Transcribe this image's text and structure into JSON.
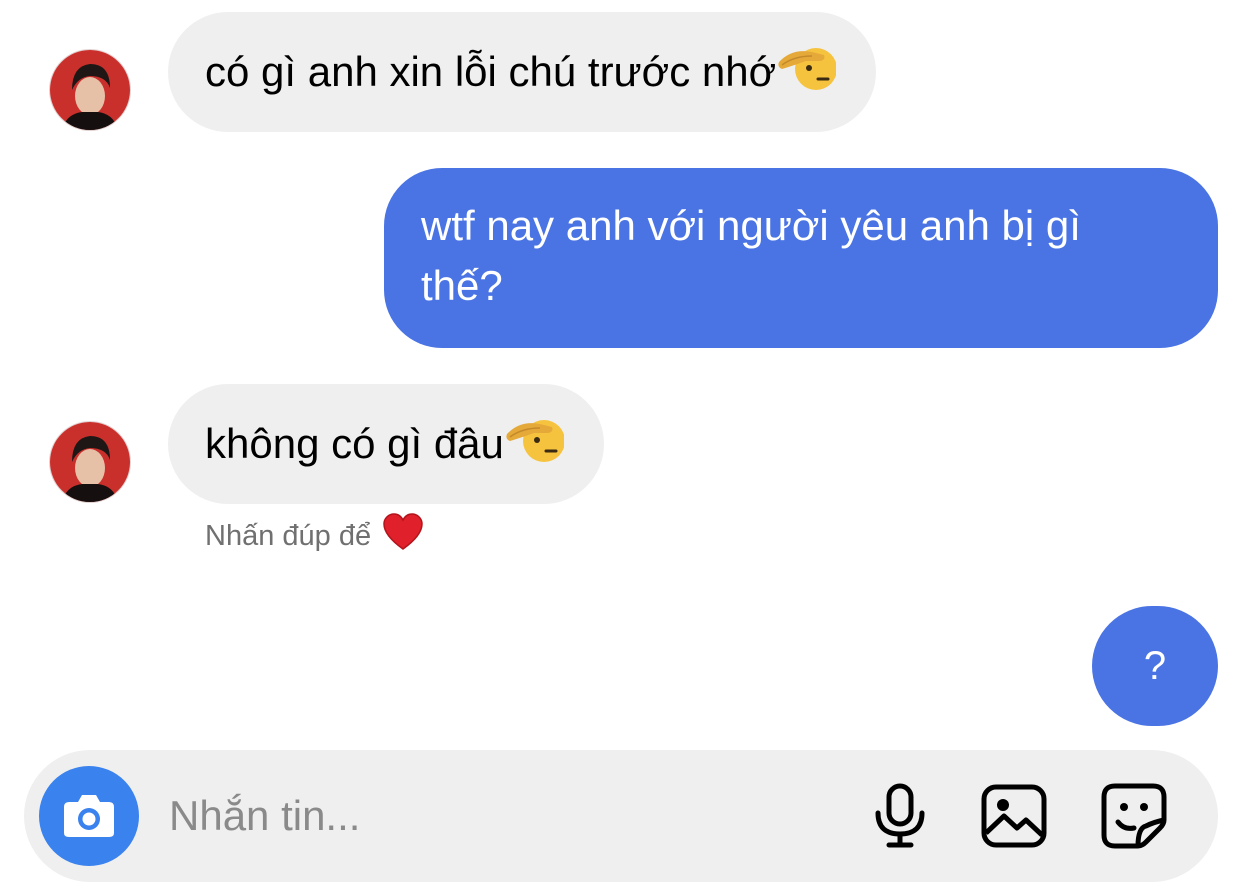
{
  "messages": [
    {
      "from": "other",
      "text": "có gì anh xin lỗi chú trước nhớ",
      "emoji": "saluting-face-emoji"
    },
    {
      "from": "me",
      "line1": "wtf nay anh với người yêu anh bị gì",
      "line2": "thế?"
    },
    {
      "from": "other",
      "text": "không có gì đâu",
      "emoji": "saluting-face-emoji"
    },
    {
      "from": "me",
      "text": "?"
    }
  ],
  "hint": {
    "text": "Nhấn đúp để",
    "icon": "heart-icon"
  },
  "composer": {
    "placeholder": "Nhắn tin...",
    "camera_icon": "camera-icon",
    "tools": [
      "microphone-icon",
      "image-icon",
      "sticker-icon"
    ]
  },
  "colors": {
    "outgoing_bubble": "#4a74e4",
    "incoming_bubble": "#efefef",
    "camera_button": "#3a82ee",
    "heart": "#e0202a"
  }
}
